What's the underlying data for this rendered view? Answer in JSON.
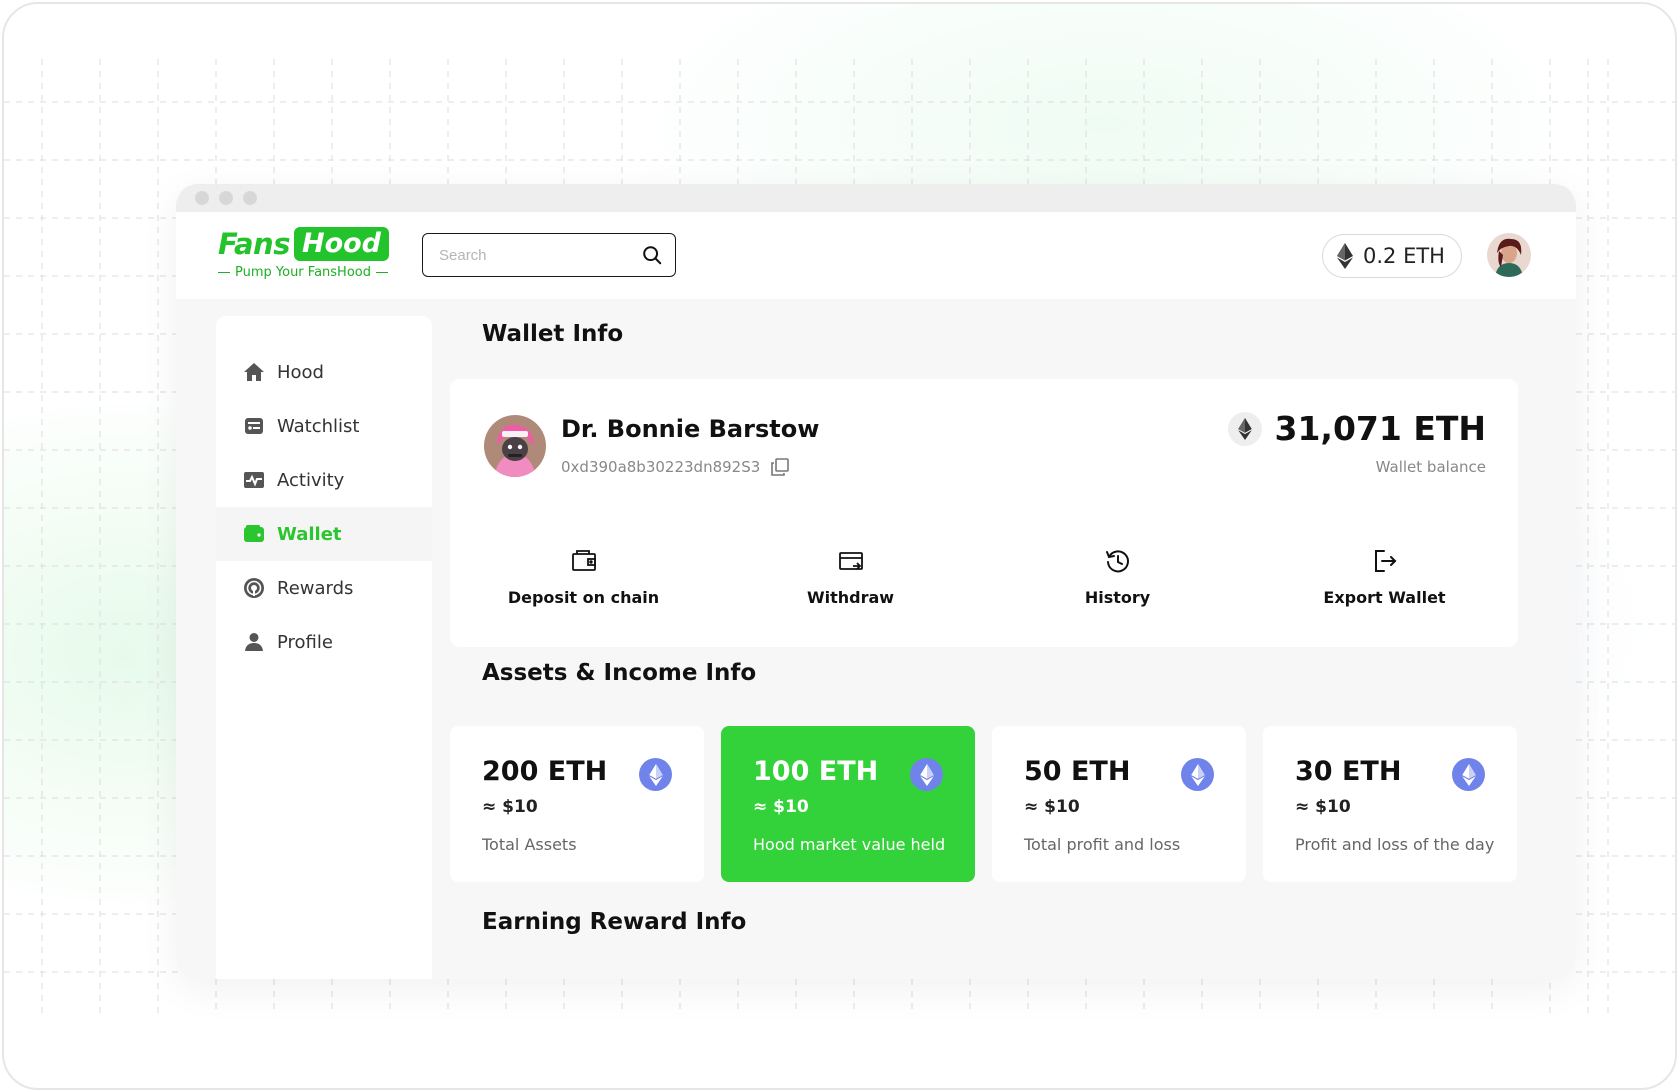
{
  "app": {
    "logo_part1": "Fans",
    "logo_part2": "Hood",
    "tagline": "Pump Your FansHood"
  },
  "search": {
    "placeholder": "Search"
  },
  "header": {
    "eth_balance": "0.2 ETH"
  },
  "sidebar": {
    "items": [
      {
        "label": "Hood",
        "icon": "home-icon"
      },
      {
        "label": "Watchlist",
        "icon": "watchlist-icon"
      },
      {
        "label": "Activity",
        "icon": "activity-icon"
      },
      {
        "label": "Wallet",
        "icon": "wallet-icon",
        "active": true
      },
      {
        "label": "Rewards",
        "icon": "rewards-icon"
      },
      {
        "label": "Profile",
        "icon": "profile-icon"
      }
    ]
  },
  "wallet": {
    "section_title": "Wallet Info",
    "user_name": "Dr. Bonnie Barstow",
    "address": "0xd390a8b30223dn892S3",
    "balance": "31,071 ETH",
    "balance_label": "Wallet balance",
    "actions": [
      {
        "label": "Deposit on chain",
        "icon": "deposit-icon"
      },
      {
        "label": "Withdraw",
        "icon": "withdraw-icon"
      },
      {
        "label": "History",
        "icon": "history-icon"
      },
      {
        "label": "Export Wallet",
        "icon": "export-icon"
      }
    ]
  },
  "assets": {
    "section_title": "Assets & Income Info",
    "cards": [
      {
        "value": "200 ETH",
        "usd": "≈ $10",
        "label": "Total Assets"
      },
      {
        "value": "100 ETH",
        "usd": "≈ $10",
        "label": "Hood market value held",
        "highlight": true
      },
      {
        "value": "50 ETH",
        "usd": "≈ $10",
        "label": "Total profit and loss"
      },
      {
        "value": "30 ETH",
        "usd": "≈ $10",
        "label": "Profit and loss of the day"
      }
    ]
  },
  "earning": {
    "section_title": "Earning Reward Info"
  },
  "colors": {
    "brand_green": "#22c32b",
    "highlight_card": "#34d23a",
    "eth_icon_blue": "#6f83ea"
  }
}
